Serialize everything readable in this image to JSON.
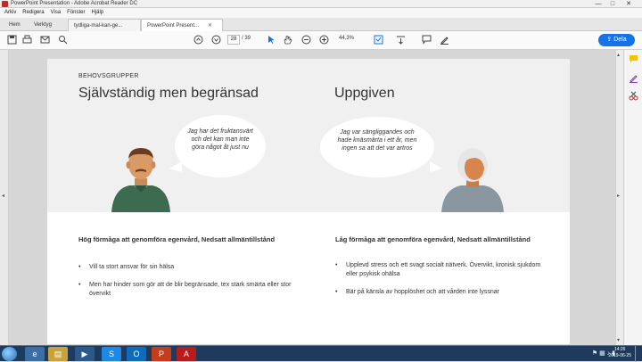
{
  "window": {
    "title": "PowerPoint Presentation - Adobe Acrobat Reader DC",
    "controls": [
      "—",
      "□",
      "✕"
    ]
  },
  "menu": [
    "Arkiv",
    "Redigera",
    "Visa",
    "Fönster",
    "Hjälp"
  ],
  "tabs": {
    "home": "Hem",
    "tools": "Verktyg",
    "doc1": "tydliga-mal-kan-ge...",
    "doc2": "PowerPoint Present..."
  },
  "toolbar": {
    "page_current": "28",
    "page_total": "/ 39",
    "zoom": "44,3%",
    "share_label": "Dela"
  },
  "slide": {
    "label": "BEHOVSGRUPPER",
    "left": {
      "heading": "Självständig men begränsad",
      "quote": "Jag har det fruktansvärt och det kan man inte göra något åt just nu",
      "section_title": "Hög förmåga att genomföra egenvård, Nedsatt allmäntillstånd",
      "bullets": [
        "Vill ta stort ansvar för sin hälsa",
        "Men har hinder som gör att de blir begränsade, tex stark smärta eller stor övervikt"
      ]
    },
    "right": {
      "heading": "Uppgiven",
      "quote": "Jag var sängliggandes och hade knäsmärta i ett år, men ingen sa att det var artros",
      "section_title": "Låg förmåga att genomföra egenvård, Nedsatt allmäntillstånd",
      "bullets": [
        "Upplevd stress och ett svagt socialt nätverk. Övervikt, kronisk sjukdom eller psykisk ohälsa",
        "Bär på känsla av hopplöshet och att vården inte lyssnar"
      ]
    }
  },
  "taskbar": {
    "clock_time": "14:26",
    "clock_date": "2019-06-25"
  },
  "colors": {
    "accent": "#1473e6",
    "taskbar": "#1e3a5c"
  }
}
